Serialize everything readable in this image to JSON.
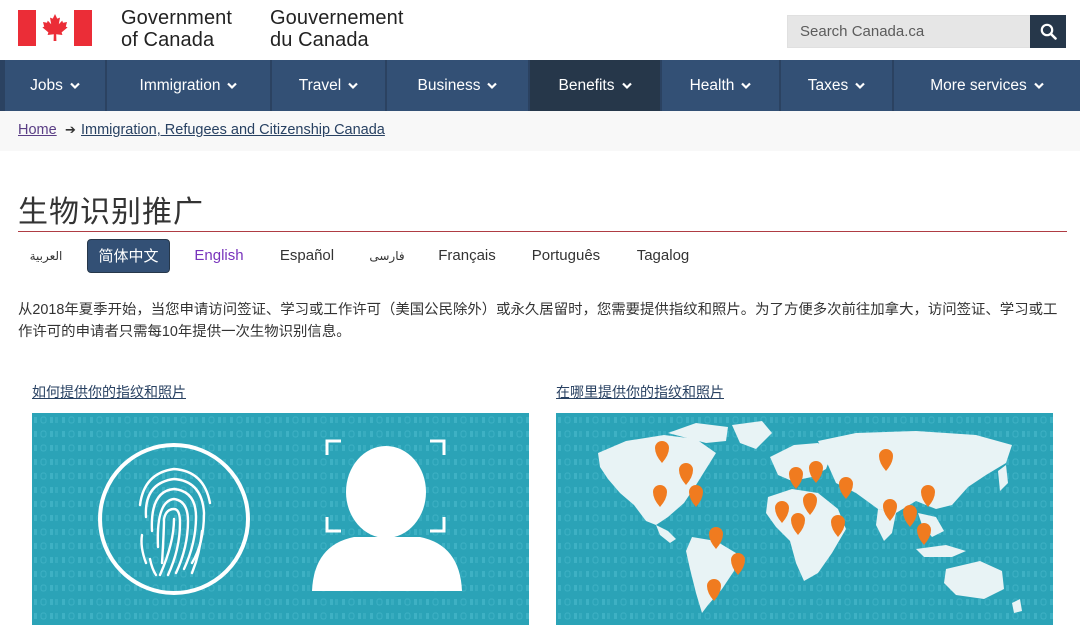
{
  "header": {
    "signature_en_line1": "Government",
    "signature_en_line2": "of Canada",
    "signature_fr_line1": "Gouvernement",
    "signature_fr_line2": "du Canada",
    "search_placeholder": "Search Canada.ca",
    "flag_color": "#eb2d37"
  },
  "nav": {
    "items": [
      {
        "label": "Jobs"
      },
      {
        "label": "Immigration"
      },
      {
        "label": "Travel"
      },
      {
        "label": "Business"
      },
      {
        "label": "Benefits",
        "active": true
      },
      {
        "label": "Health"
      },
      {
        "label": "Taxes"
      },
      {
        "label": "More services"
      }
    ],
    "bg_color": "#335075",
    "active_color": "#26374a"
  },
  "breadcrumb": {
    "home": "Home",
    "separator": "➔",
    "current": "Immigration, Refugees and Citizenship Canada"
  },
  "page": {
    "title": "生物识别推广",
    "rule_color": "#af3c43"
  },
  "languages": [
    {
      "label": "العربية"
    },
    {
      "label": "简体中文",
      "active": true
    },
    {
      "label": "English"
    },
    {
      "label": "Español"
    },
    {
      "label": "فارسی"
    },
    {
      "label": "Français"
    },
    {
      "label": "Português"
    },
    {
      "label": "Tagalog"
    }
  ],
  "intro": "从2018年夏季开始，当您申请访问签证、学习或工作许可（美国公民除外）或永久居留时，您需要提供指纹和照片。为了方便多次前往加拿大，访问签证、学习或工作许可的申请者只需每10年提供一次生物识别信息。",
  "cards": [
    {
      "link": "如何提供你的指纹和照片",
      "image": "fingerprint-and-face-illustration"
    },
    {
      "link": "在哪里提供你的指纹和照片",
      "image": "world-map-locations-illustration"
    }
  ],
  "colors": {
    "card_bg": "#2ba3b7",
    "pin": "#f07b1f"
  }
}
